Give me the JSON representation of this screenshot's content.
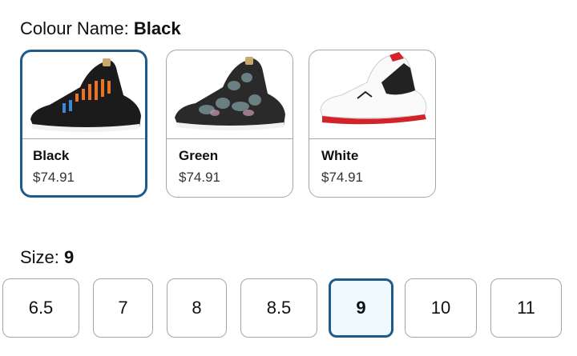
{
  "colour": {
    "label": "Colour Name: ",
    "selected": "Black",
    "options": [
      {
        "name": "Black",
        "price": "$74.91"
      },
      {
        "name": "Green",
        "price": "$74.91"
      },
      {
        "name": "White",
        "price": "$74.91"
      }
    ]
  },
  "size": {
    "label": "Size: ",
    "selected": "9",
    "options": [
      "6.5",
      "7",
      "8",
      "8.5",
      "9",
      "10",
      "11"
    ]
  },
  "colors": {
    "selected_border": "#1f5b8a",
    "selected_bg": "#eefafd",
    "border": "#a6a6a6"
  }
}
